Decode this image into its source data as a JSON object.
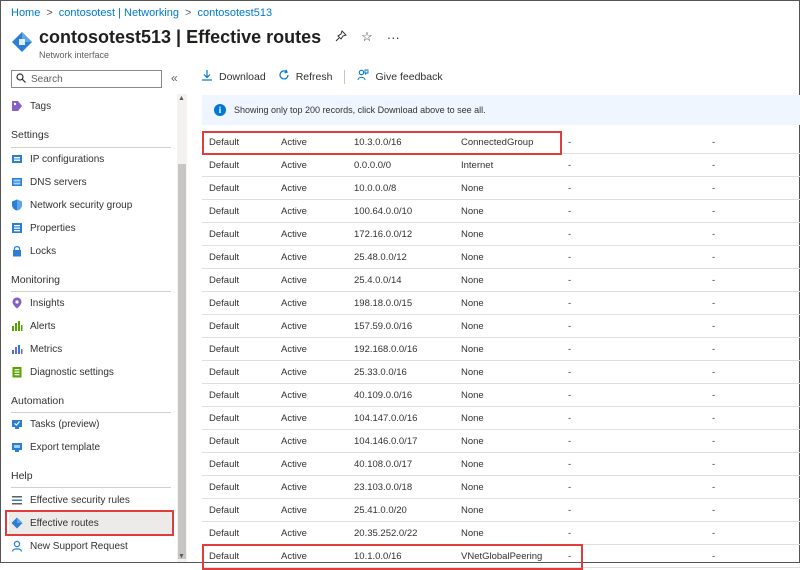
{
  "breadcrumb": [
    "Home",
    "contosotest | Networking",
    "contosotest513"
  ],
  "header": {
    "title": "contosotest513 | Effective routes",
    "subtitle": "Network interface",
    "more": "···"
  },
  "search": {
    "placeholder": "Search"
  },
  "sidebar": {
    "collapse": "«",
    "tags": "Tags",
    "settings_label": "Settings",
    "settings": [
      "IP configurations",
      "DNS servers",
      "Network security group",
      "Properties",
      "Locks"
    ],
    "monitoring_label": "Monitoring",
    "monitoring": [
      "Insights",
      "Alerts",
      "Metrics",
      "Diagnostic settings"
    ],
    "automation_label": "Automation",
    "automation": [
      "Tasks (preview)",
      "Export template"
    ],
    "help_label": "Help",
    "help": [
      "Effective security rules",
      "Effective routes",
      "New Support Request"
    ]
  },
  "toolbar": {
    "download": "Download",
    "refresh": "Refresh",
    "feedback": "Give feedback"
  },
  "info": "Showing only top 200 records, click Download above to see all.",
  "routes": [
    [
      "Default",
      "Active",
      "10.3.0.0/16",
      "ConnectedGroup",
      "-",
      "-"
    ],
    [
      "Default",
      "Active",
      "0.0.0.0/0",
      "Internet",
      "-",
      "-"
    ],
    [
      "Default",
      "Active",
      "10.0.0.0/8",
      "None",
      "-",
      "-"
    ],
    [
      "Default",
      "Active",
      "100.64.0.0/10",
      "None",
      "-",
      "-"
    ],
    [
      "Default",
      "Active",
      "172.16.0.0/12",
      "None",
      "-",
      "-"
    ],
    [
      "Default",
      "Active",
      "25.48.0.0/12",
      "None",
      "-",
      "-"
    ],
    [
      "Default",
      "Active",
      "25.4.0.0/14",
      "None",
      "-",
      "-"
    ],
    [
      "Default",
      "Active",
      "198.18.0.0/15",
      "None",
      "-",
      "-"
    ],
    [
      "Default",
      "Active",
      "157.59.0.0/16",
      "None",
      "-",
      "-"
    ],
    [
      "Default",
      "Active",
      "192.168.0.0/16",
      "None",
      "-",
      "-"
    ],
    [
      "Default",
      "Active",
      "25.33.0.0/16",
      "None",
      "-",
      "-"
    ],
    [
      "Default",
      "Active",
      "40.109.0.0/16",
      "None",
      "-",
      "-"
    ],
    [
      "Default",
      "Active",
      "104.147.0.0/16",
      "None",
      "-",
      "-"
    ],
    [
      "Default",
      "Active",
      "104.146.0.0/17",
      "None",
      "-",
      "-"
    ],
    [
      "Default",
      "Active",
      "40.108.0.0/17",
      "None",
      "-",
      "-"
    ],
    [
      "Default",
      "Active",
      "23.103.0.0/18",
      "None",
      "-",
      "-"
    ],
    [
      "Default",
      "Active",
      "25.41.0.0/20",
      "None",
      "-",
      "-"
    ],
    [
      "Default",
      "Active",
      "20.35.252.0/22",
      "None",
      "-",
      "-"
    ],
    [
      "Default",
      "Active",
      "10.1.0.0/16",
      "VNetGlobalPeering",
      "-",
      "-"
    ]
  ],
  "colors": {
    "accent": "#0078d4",
    "highlight": "#e03c3c"
  }
}
